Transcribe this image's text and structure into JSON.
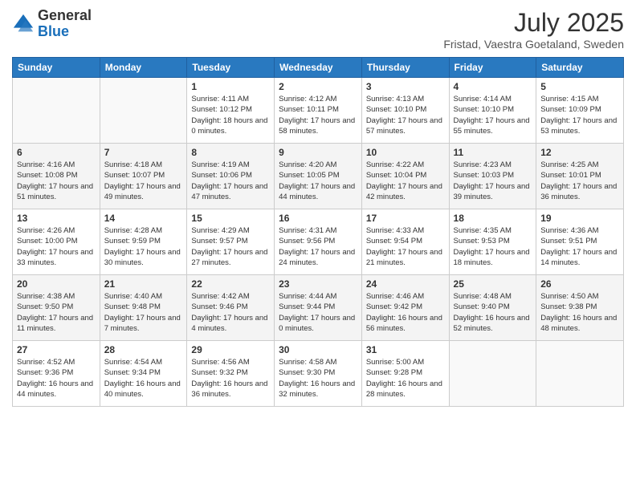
{
  "header": {
    "logo_general": "General",
    "logo_blue": "Blue",
    "month_title": "July 2025",
    "location": "Fristad, Vaestra Goetaland, Sweden"
  },
  "days_of_week": [
    "Sunday",
    "Monday",
    "Tuesday",
    "Wednesday",
    "Thursday",
    "Friday",
    "Saturday"
  ],
  "weeks": [
    [
      {
        "day": "",
        "info": ""
      },
      {
        "day": "",
        "info": ""
      },
      {
        "day": "1",
        "info": "Sunrise: 4:11 AM\nSunset: 10:12 PM\nDaylight: 18 hours and 0 minutes."
      },
      {
        "day": "2",
        "info": "Sunrise: 4:12 AM\nSunset: 10:11 PM\nDaylight: 17 hours and 58 minutes."
      },
      {
        "day": "3",
        "info": "Sunrise: 4:13 AM\nSunset: 10:10 PM\nDaylight: 17 hours and 57 minutes."
      },
      {
        "day": "4",
        "info": "Sunrise: 4:14 AM\nSunset: 10:10 PM\nDaylight: 17 hours and 55 minutes."
      },
      {
        "day": "5",
        "info": "Sunrise: 4:15 AM\nSunset: 10:09 PM\nDaylight: 17 hours and 53 minutes."
      }
    ],
    [
      {
        "day": "6",
        "info": "Sunrise: 4:16 AM\nSunset: 10:08 PM\nDaylight: 17 hours and 51 minutes."
      },
      {
        "day": "7",
        "info": "Sunrise: 4:18 AM\nSunset: 10:07 PM\nDaylight: 17 hours and 49 minutes."
      },
      {
        "day": "8",
        "info": "Sunrise: 4:19 AM\nSunset: 10:06 PM\nDaylight: 17 hours and 47 minutes."
      },
      {
        "day": "9",
        "info": "Sunrise: 4:20 AM\nSunset: 10:05 PM\nDaylight: 17 hours and 44 minutes."
      },
      {
        "day": "10",
        "info": "Sunrise: 4:22 AM\nSunset: 10:04 PM\nDaylight: 17 hours and 42 minutes."
      },
      {
        "day": "11",
        "info": "Sunrise: 4:23 AM\nSunset: 10:03 PM\nDaylight: 17 hours and 39 minutes."
      },
      {
        "day": "12",
        "info": "Sunrise: 4:25 AM\nSunset: 10:01 PM\nDaylight: 17 hours and 36 minutes."
      }
    ],
    [
      {
        "day": "13",
        "info": "Sunrise: 4:26 AM\nSunset: 10:00 PM\nDaylight: 17 hours and 33 minutes."
      },
      {
        "day": "14",
        "info": "Sunrise: 4:28 AM\nSunset: 9:59 PM\nDaylight: 17 hours and 30 minutes."
      },
      {
        "day": "15",
        "info": "Sunrise: 4:29 AM\nSunset: 9:57 PM\nDaylight: 17 hours and 27 minutes."
      },
      {
        "day": "16",
        "info": "Sunrise: 4:31 AM\nSunset: 9:56 PM\nDaylight: 17 hours and 24 minutes."
      },
      {
        "day": "17",
        "info": "Sunrise: 4:33 AM\nSunset: 9:54 PM\nDaylight: 17 hours and 21 minutes."
      },
      {
        "day": "18",
        "info": "Sunrise: 4:35 AM\nSunset: 9:53 PM\nDaylight: 17 hours and 18 minutes."
      },
      {
        "day": "19",
        "info": "Sunrise: 4:36 AM\nSunset: 9:51 PM\nDaylight: 17 hours and 14 minutes."
      }
    ],
    [
      {
        "day": "20",
        "info": "Sunrise: 4:38 AM\nSunset: 9:50 PM\nDaylight: 17 hours and 11 minutes."
      },
      {
        "day": "21",
        "info": "Sunrise: 4:40 AM\nSunset: 9:48 PM\nDaylight: 17 hours and 7 minutes."
      },
      {
        "day": "22",
        "info": "Sunrise: 4:42 AM\nSunset: 9:46 PM\nDaylight: 17 hours and 4 minutes."
      },
      {
        "day": "23",
        "info": "Sunrise: 4:44 AM\nSunset: 9:44 PM\nDaylight: 17 hours and 0 minutes."
      },
      {
        "day": "24",
        "info": "Sunrise: 4:46 AM\nSunset: 9:42 PM\nDaylight: 16 hours and 56 minutes."
      },
      {
        "day": "25",
        "info": "Sunrise: 4:48 AM\nSunset: 9:40 PM\nDaylight: 16 hours and 52 minutes."
      },
      {
        "day": "26",
        "info": "Sunrise: 4:50 AM\nSunset: 9:38 PM\nDaylight: 16 hours and 48 minutes."
      }
    ],
    [
      {
        "day": "27",
        "info": "Sunrise: 4:52 AM\nSunset: 9:36 PM\nDaylight: 16 hours and 44 minutes."
      },
      {
        "day": "28",
        "info": "Sunrise: 4:54 AM\nSunset: 9:34 PM\nDaylight: 16 hours and 40 minutes."
      },
      {
        "day": "29",
        "info": "Sunrise: 4:56 AM\nSunset: 9:32 PM\nDaylight: 16 hours and 36 minutes."
      },
      {
        "day": "30",
        "info": "Sunrise: 4:58 AM\nSunset: 9:30 PM\nDaylight: 16 hours and 32 minutes."
      },
      {
        "day": "31",
        "info": "Sunrise: 5:00 AM\nSunset: 9:28 PM\nDaylight: 16 hours and 28 minutes."
      },
      {
        "day": "",
        "info": ""
      },
      {
        "day": "",
        "info": ""
      }
    ]
  ]
}
